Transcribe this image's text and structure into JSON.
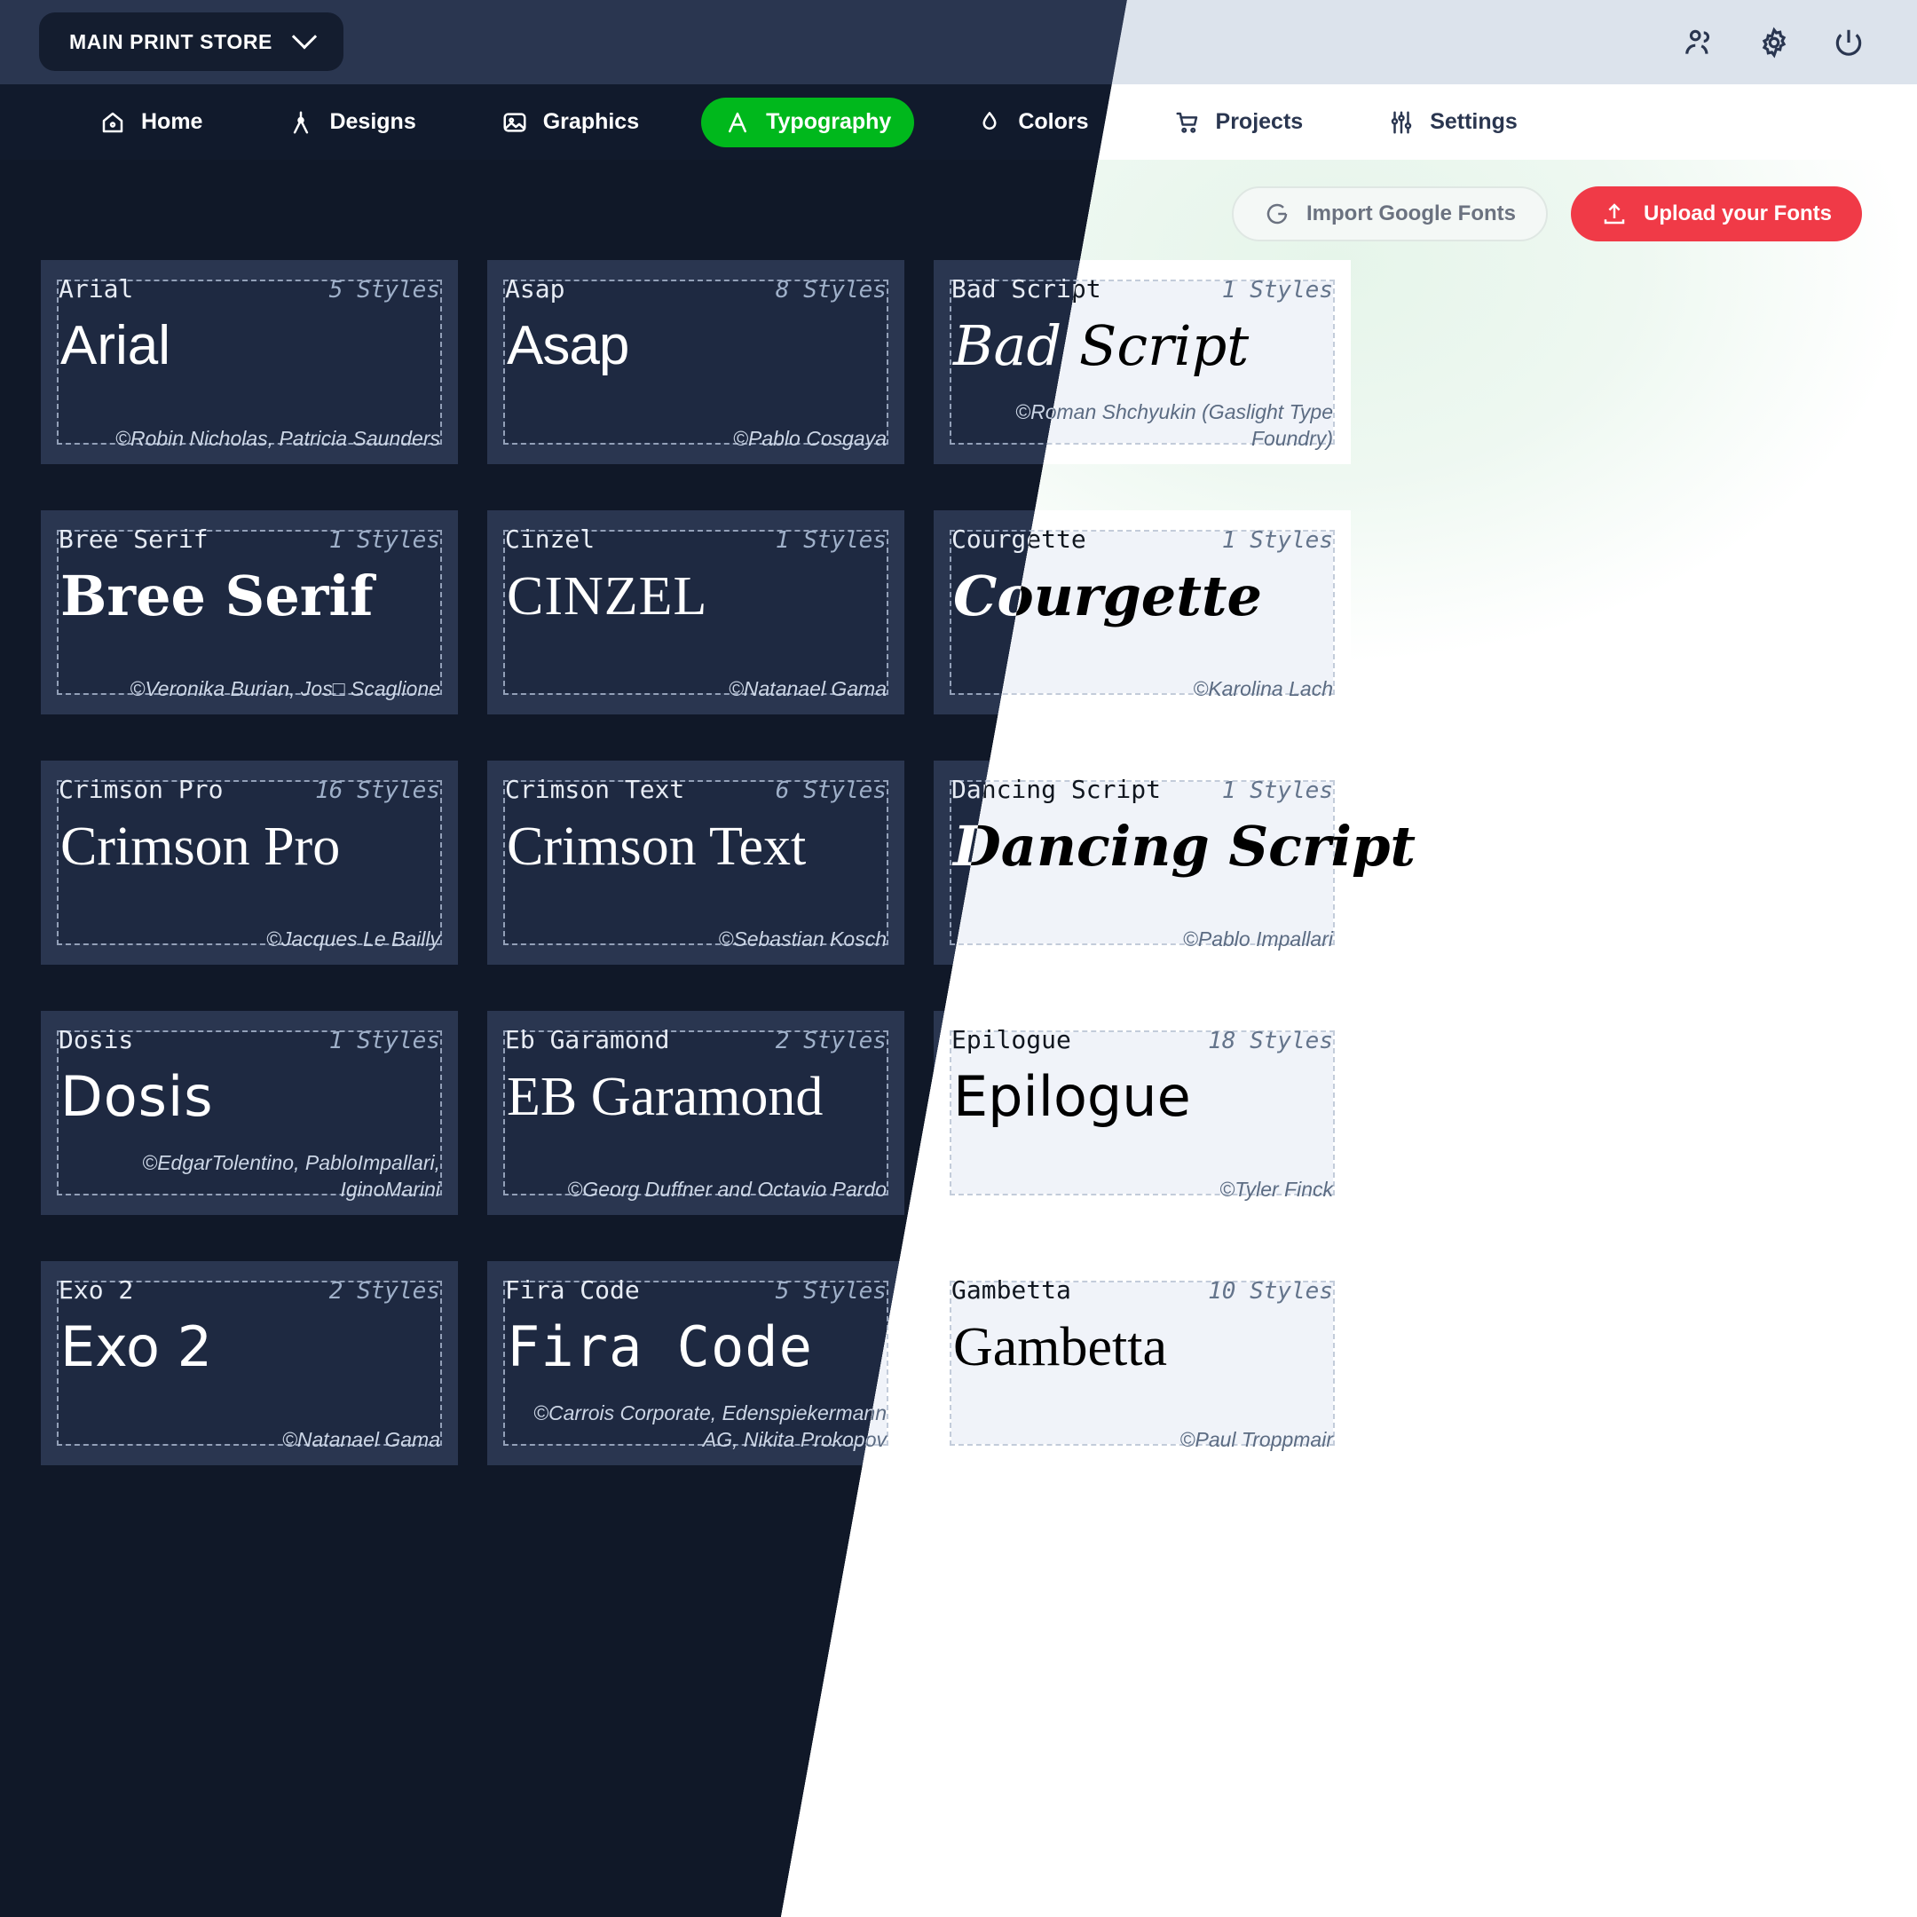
{
  "header": {
    "store_label": "MAIN PRINT STORE",
    "icons": [
      {
        "name": "users-icon"
      },
      {
        "name": "gear-icon"
      },
      {
        "name": "power-icon"
      }
    ]
  },
  "nav": {
    "items": [
      {
        "label": "Home",
        "icon": "home-icon",
        "active": false
      },
      {
        "label": "Designs",
        "icon": "compass-icon",
        "active": false
      },
      {
        "label": "Graphics",
        "icon": "image-icon",
        "active": false
      },
      {
        "label": "Typography",
        "icon": "letter-a-icon",
        "active": true
      },
      {
        "label": "Colors",
        "icon": "droplet-icon",
        "active": false
      },
      {
        "label": "Projects",
        "icon": "cart-icon",
        "active": false
      },
      {
        "label": "Settings",
        "icon": "sliders-icon",
        "active": false
      }
    ]
  },
  "actions": {
    "import_label": "Import Google Fonts",
    "import_icon": "google-g-icon",
    "upload_label": "Upload your Fonts",
    "upload_icon": "upload-icon"
  },
  "colors": {
    "accent_green": "#00b81c",
    "accent_red": "#f03a47",
    "dark_bg": "#101828",
    "dark_navbar": "#111a2c",
    "dark_topbar": "#2a3650",
    "dark_card": "#2a3650",
    "dark_card_inner": "#1e2941",
    "light_bg": "#ffffff",
    "light_topbar": "#dce3ec",
    "light_card_inner": "#f0f3f9"
  },
  "fonts": [
    {
      "name": "Arial",
      "styles": "5 Styles",
      "sample": "Arial",
      "credit": "©Robin Nicholas, Patricia Saunders",
      "class": "s-sans"
    },
    {
      "name": "Asap",
      "styles": "8 Styles",
      "sample": "Asap",
      "credit": "©Pablo Cosgaya",
      "class": "s-sans-cond"
    },
    {
      "name": "Bad Script",
      "styles": "1 Styles",
      "sample": "Bad Script",
      "credit": "©Roman Shchyukin (Gaslight Type Foundry)",
      "class": "s-script"
    },
    {
      "name": "Bree Serif",
      "styles": "1 Styles",
      "sample": "Bree Serif",
      "credit": "©Veronika Burian, Jos□ Scaglione",
      "class": "s-slab"
    },
    {
      "name": "Cinzel",
      "styles": "1 Styles",
      "sample": "CINZEL",
      "credit": "©Natanael Gama",
      "class": "s-caps"
    },
    {
      "name": "Courgette",
      "styles": "1 Styles",
      "sample": "Courgette",
      "credit": "©Karolina Lach",
      "class": "s-script-b"
    },
    {
      "name": "Crimson Pro",
      "styles": "16 Styles",
      "sample": "Crimson Pro",
      "credit": "©Jacques Le Bailly",
      "class": "s-serif"
    },
    {
      "name": "Crimson Text",
      "styles": "6 Styles",
      "sample": "Crimson Text",
      "credit": "©Sebastian Kosch",
      "class": "s-serif"
    },
    {
      "name": "Dancing Script",
      "styles": "1 Styles",
      "sample": "Dancing Script",
      "credit": "©Pablo Impallari",
      "class": "s-script-b"
    },
    {
      "name": "Dosis",
      "styles": "1 Styles",
      "sample": "Dosis",
      "credit": "©EdgarTolentino, PabloImpallari, IginoMarini",
      "class": "s-light"
    },
    {
      "name": "Eb Garamond",
      "styles": "2 Styles",
      "sample": "EB Garamond",
      "credit": "©Georg Duffner and Octavio Pardo",
      "class": "s-serif"
    },
    {
      "name": "Epilogue",
      "styles": "18 Styles",
      "sample": "Epilogue",
      "credit": "©Tyler Finck",
      "class": "s-dejavu"
    },
    {
      "name": "Exo 2",
      "styles": "2 Styles",
      "sample": "Exo 2",
      "credit": "©Natanael Gama",
      "class": "s-dejavu"
    },
    {
      "name": "Fira Code",
      "styles": "5 Styles",
      "sample": "Fira Code",
      "credit": "©Carrois Corporate, Edenspiekermann AG, Nikita Prokopov",
      "class": "s-mono"
    },
    {
      "name": "Gambetta",
      "styles": "10 Styles",
      "sample": "Gambetta",
      "credit": "©Paul Troppmair",
      "class": "s-serif"
    }
  ]
}
